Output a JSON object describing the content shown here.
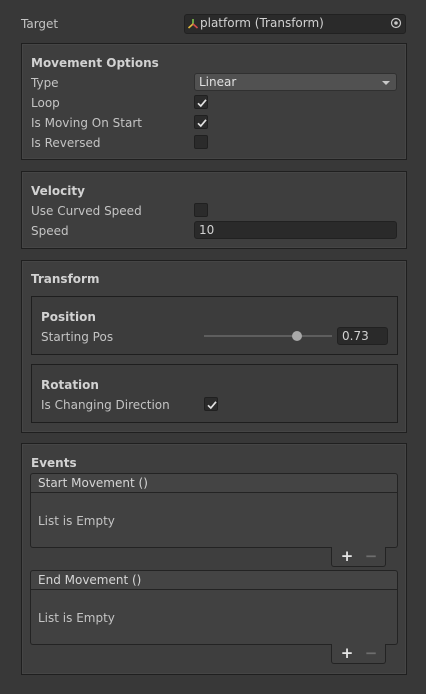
{
  "target": {
    "label": "Target",
    "value": "platform (Transform)",
    "icon": "transform-icon"
  },
  "movement": {
    "header": "Movement Options",
    "type_label": "Type",
    "type_value": "Linear",
    "loop_label": "Loop",
    "loop_checked": true,
    "moving_on_start_label": "Is Moving On Start",
    "moving_on_start_checked": true,
    "reversed_label": "Is Reversed",
    "reversed_checked": false
  },
  "velocity": {
    "header": "Velocity",
    "curved_label": "Use Curved Speed",
    "curved_checked": false,
    "speed_label": "Speed",
    "speed_value": "10"
  },
  "transform": {
    "header": "Transform",
    "position": {
      "header": "Position",
      "starting_pos_label": "Starting Pos",
      "starting_pos_value": "0.73",
      "slider_fraction": 0.73
    },
    "rotation": {
      "header": "Rotation",
      "changing_dir_label": "Is Changing Direction",
      "changing_dir_checked": true
    }
  },
  "events": {
    "header": "Events",
    "start": {
      "title": "Start Movement ()",
      "empty_text": "List is Empty"
    },
    "end": {
      "title": "End Movement ()",
      "empty_text": "List is Empty"
    },
    "add_symbol": "+",
    "remove_symbol": "−"
  }
}
